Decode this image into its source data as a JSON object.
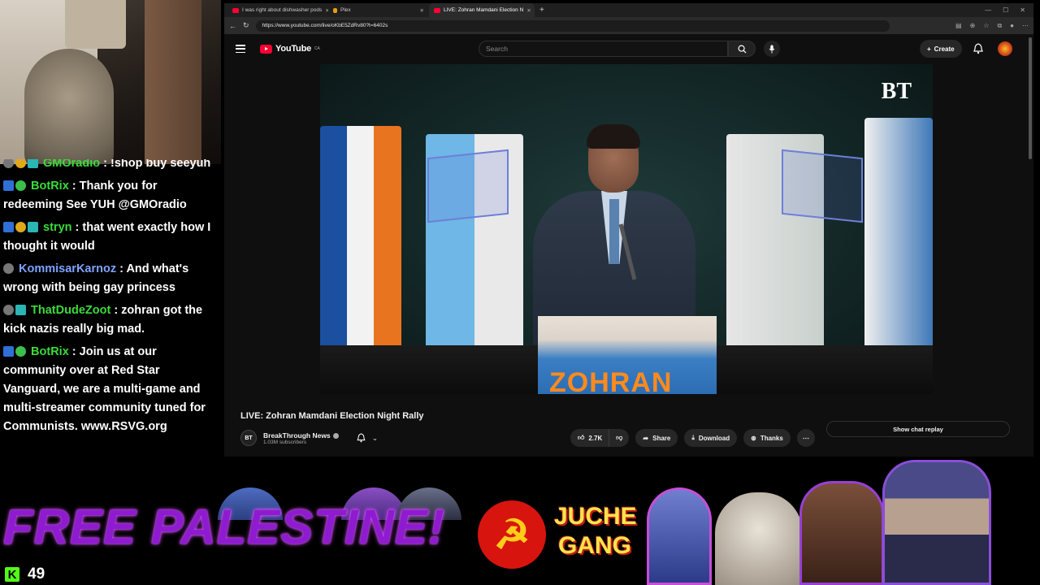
{
  "browser": {
    "tabs": [
      {
        "title": "I was right about dishwasher pods",
        "type": "youtube"
      },
      {
        "title": "Plex",
        "type": "plex"
      },
      {
        "title": "LIVE: Zohran Mamdani Election N",
        "type": "youtube",
        "active": true
      }
    ],
    "url": "https://www.youtube.com/live/oKbE5ZdRv80?t=6402s"
  },
  "youtube": {
    "logo_text": "YouTube",
    "region": "CA",
    "search_placeholder": "Search",
    "create_label": "Create",
    "video_title": "LIVE: Zohran Mamdani Election Night Rally",
    "channel_name": "BreakThrough News",
    "channel_initials": "BT",
    "subscribers": "1.03M subscribers",
    "likes": "2.7K",
    "share_label": "Share",
    "download_label": "Download",
    "thanks_label": "Thanks",
    "show_chat_replay_label": "Show chat replay",
    "video_logo": "BT",
    "podium_text": "ZOHRAN"
  },
  "chat": {
    "messages": [
      {
        "user": "GMOradio",
        "user_color": "#3bdc3b",
        "text": ": !shop buy seeyuh",
        "badges": [
          "gray",
          "gold",
          "cyan"
        ]
      },
      {
        "user": "BotRix",
        "user_color": "#3bdc3b",
        "text": ": Thank you for redeeming See YUH @GMOradio",
        "badges": [
          "blue",
          "green"
        ]
      },
      {
        "user": "stryn",
        "user_color": "#3bdc3b",
        "text": ": that went exactly how I thought it would",
        "badges": [
          "blue",
          "gold",
          "cyan"
        ]
      },
      {
        "user": "KommisarKarnoz",
        "user_color": "#7fa2ff",
        "text": ": And what's wrong with being gay princess",
        "badges": [
          "gray"
        ]
      },
      {
        "user": "ThatDudeZoot",
        "user_color": "#3bdc3b",
        "text": ": zohran got the kick nazis really big mad.",
        "badges": [
          "gray",
          "cyan"
        ]
      },
      {
        "user": "BotRix",
        "user_color": "#3bdc3b",
        "text": ": Join us at our community over at Red Star Vanguard, we are a multi-game and multi-streamer community tuned for Communists. www.RSVG.org",
        "badges": [
          "blue",
          "green"
        ]
      }
    ]
  },
  "overlay": {
    "banner_text": "FREE PALESTINE!",
    "juche_line1": "JUCHE",
    "juche_line2": "GANG",
    "viewer_count": "49",
    "kick_letter": "K",
    "colors": {
      "banner": "#8f1bd0",
      "kick": "#53fc18",
      "youtube_red": "#ff0033"
    }
  }
}
